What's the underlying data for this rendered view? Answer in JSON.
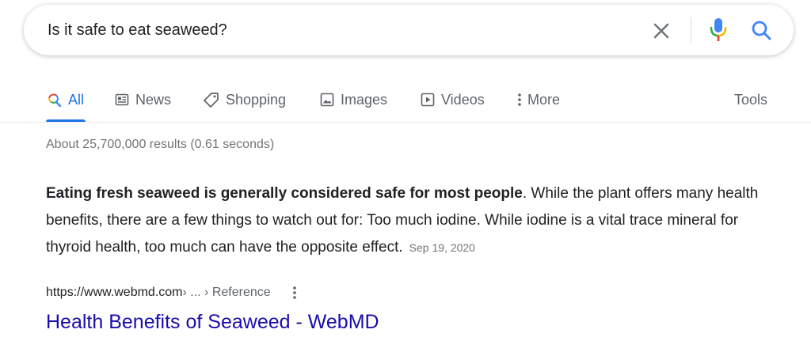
{
  "search": {
    "query": "Is it safe to eat seaweed?",
    "icons": [
      "close-icon",
      "mic-icon",
      "search-icon"
    ]
  },
  "tabs": [
    {
      "label": "All",
      "icon": "search-icon",
      "active": true
    },
    {
      "label": "News",
      "icon": "news-icon"
    },
    {
      "label": "Shopping",
      "icon": "tag-icon"
    },
    {
      "label": "Images",
      "icon": "image-icon"
    },
    {
      "label": "Videos",
      "icon": "play-icon"
    },
    {
      "label": "More",
      "icon": "more-vert-icon"
    }
  ],
  "tools_label": "Tools",
  "result_stats": "About 25,700,000 results (0.61 seconds)",
  "featured_snippet": {
    "bold_text": "Eating fresh seaweed is generally considered safe for most people",
    "text": ". While the plant offers many health benefits, there are a few things to watch out for: Too much iodine. While iodine is a vital trace mineral for thyroid health, too much can have the opposite effect.",
    "date": "Sep 19, 2020"
  },
  "result": {
    "url": "https://www.webmd.com",
    "breadcrumb": " › ... › Reference",
    "title": "Health Benefits of Seaweed - WebMD"
  },
  "colors": {
    "link": "#1a0dab",
    "accent": "#1a73e8",
    "muted": "#70757a"
  }
}
